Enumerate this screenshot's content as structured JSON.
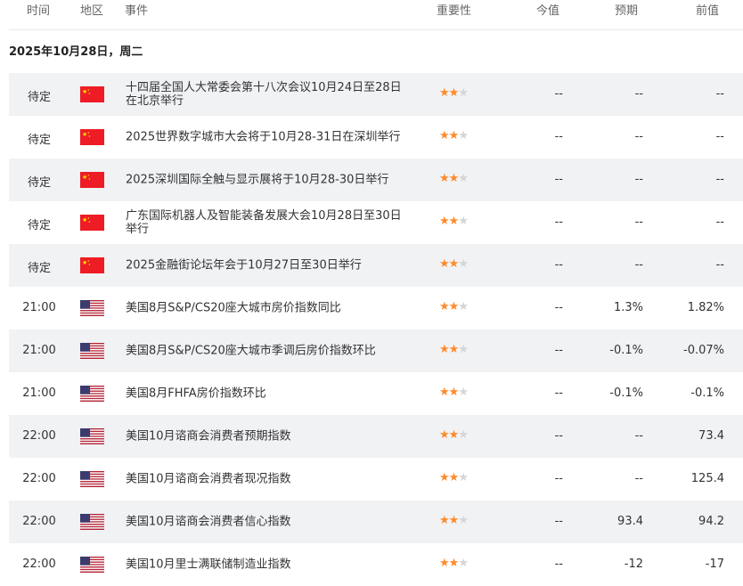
{
  "headers": {
    "time": "时间",
    "region": "地区",
    "event": "事件",
    "importance": "重要性",
    "actual": "今值",
    "forecast": "预期",
    "previous": "前值"
  },
  "date": "2025年10月28日，周二",
  "colors": {
    "star_on": "#ff8a2a",
    "star_off": "#d5d5d5",
    "row_alt": "#f1f2f4"
  },
  "rows": [
    {
      "time": "待定",
      "region": "china-flag",
      "event": "十四届全国人大常委会第十八次会议10月24日至28日在北京举行",
      "stars": 2,
      "actual": "--",
      "forecast": "--",
      "previous": "--"
    },
    {
      "time": "待定",
      "region": "china-flag",
      "event": "2025世界数字城市大会将于10月28-31日在深圳举行",
      "stars": 2,
      "actual": "--",
      "forecast": "--",
      "previous": "--"
    },
    {
      "time": "待定",
      "region": "china-flag",
      "event": "2025深圳国际全触与显示展将于10月28-30日举行",
      "stars": 2,
      "actual": "--",
      "forecast": "--",
      "previous": "--"
    },
    {
      "time": "待定",
      "region": "china-flag",
      "event": "广东国际机器人及智能装备发展大会10月28日至30日举行",
      "stars": 2,
      "actual": "--",
      "forecast": "--",
      "previous": "--"
    },
    {
      "time": "待定",
      "region": "china-flag",
      "event": "2025金融街论坛年会于10月27日至30日举行",
      "stars": 2,
      "actual": "--",
      "forecast": "--",
      "previous": "--"
    },
    {
      "time": "21:00",
      "region": "us-flag",
      "event": "美国8月S&P/CS20座大城市房价指数同比",
      "stars": 2,
      "actual": "--",
      "forecast": "1.3%",
      "previous": "1.82%"
    },
    {
      "time": "21:00",
      "region": "us-flag",
      "event": "美国8月S&P/CS20座大城市季调后房价指数环比",
      "stars": 2,
      "actual": "--",
      "forecast": "-0.1%",
      "previous": "-0.07%"
    },
    {
      "time": "21:00",
      "region": "us-flag",
      "event": "美国8月FHFA房价指数环比",
      "stars": 2,
      "actual": "--",
      "forecast": "-0.1%",
      "previous": "-0.1%"
    },
    {
      "time": "22:00",
      "region": "us-flag",
      "event": "美国10月谘商会消费者预期指数",
      "stars": 2,
      "actual": "--",
      "forecast": "--",
      "previous": "73.4"
    },
    {
      "time": "22:00",
      "region": "us-flag",
      "event": "美国10月谘商会消费者现况指数",
      "stars": 2,
      "actual": "--",
      "forecast": "--",
      "previous": "125.4"
    },
    {
      "time": "22:00",
      "region": "us-flag",
      "event": "美国10月谘商会消费者信心指数",
      "stars": 2,
      "actual": "--",
      "forecast": "93.4",
      "previous": "94.2"
    },
    {
      "time": "22:00",
      "region": "us-flag",
      "event": "美国10月里士满联储制造业指数",
      "stars": 2,
      "actual": "--",
      "forecast": "-12",
      "previous": "-17"
    }
  ]
}
